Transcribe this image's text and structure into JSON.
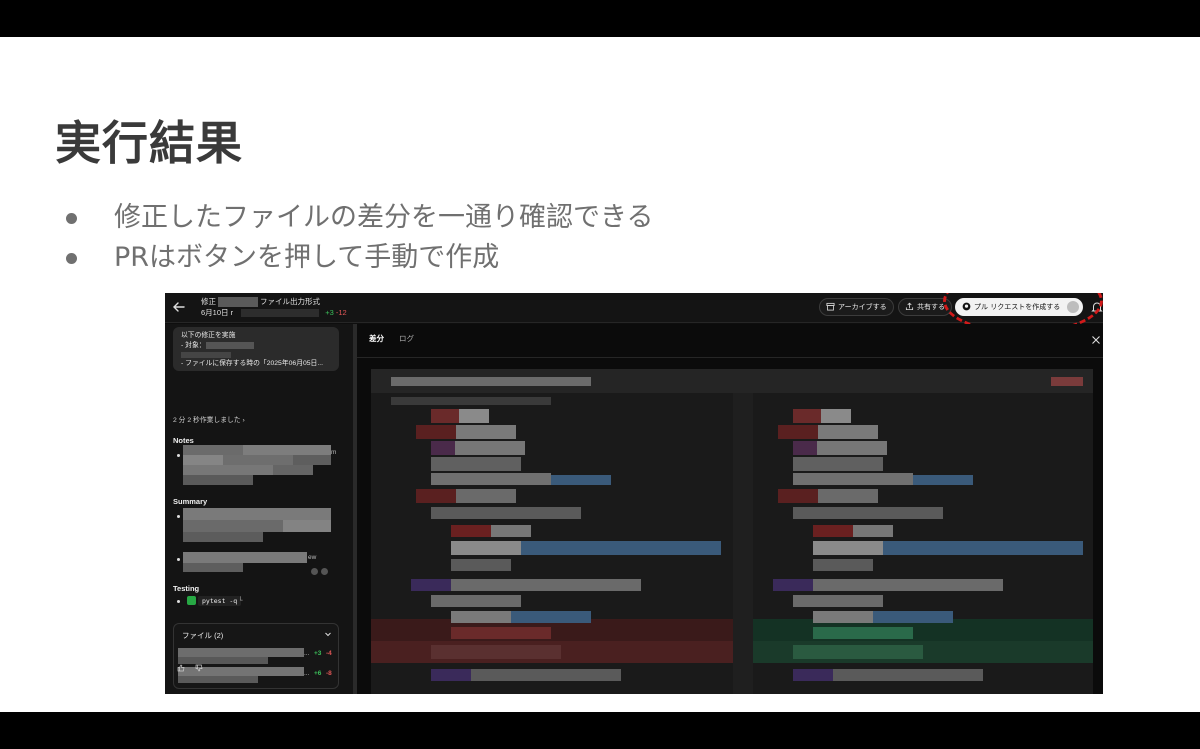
{
  "slide": {
    "title": "実行結果",
    "bullets": [
      "修正したファイルの差分を一通り確認できる",
      "PRはボタンを押して手動で作成"
    ]
  },
  "app": {
    "task_title_prefix": "修正",
    "task_title_suffix": "ファイル出力形式",
    "task_date": "6月10日",
    "task_date_suffix": "r",
    "diff_added": "+3",
    "diff_removed": "-12",
    "toolbar": {
      "archive_label": "アーカイブする",
      "share_label": "共有する",
      "create_pr_label": "プル リクエストを作成する"
    },
    "message": {
      "line1": "以下の修正を実施",
      "line2": "- 対象：",
      "line3": "- ファイルに保存する時の「2025年06月05日..."
    },
    "worked_label": "2 分 2 秒作業しました",
    "worked_chevron": "›",
    "sections": {
      "notes": "Notes",
      "summary": "Summary",
      "testing": "Testing"
    },
    "fragments": {
      "notes_tail": "m",
      "summary_tail": "ew"
    },
    "testing_command": "pytest -q",
    "testing_suffix": "└",
    "files": {
      "title": "ファイル (2)",
      "rows": [
        {
          "added": "+3",
          "removed": "-4"
        },
        {
          "added": "+6",
          "removed": "-8"
        }
      ],
      "ellipsis": "..."
    },
    "tabs": {
      "diff": "差分",
      "log": "ログ"
    }
  },
  "colors": {
    "highlight": "#d11a1a",
    "added": "#3bbf5a",
    "removed": "#e05656"
  }
}
